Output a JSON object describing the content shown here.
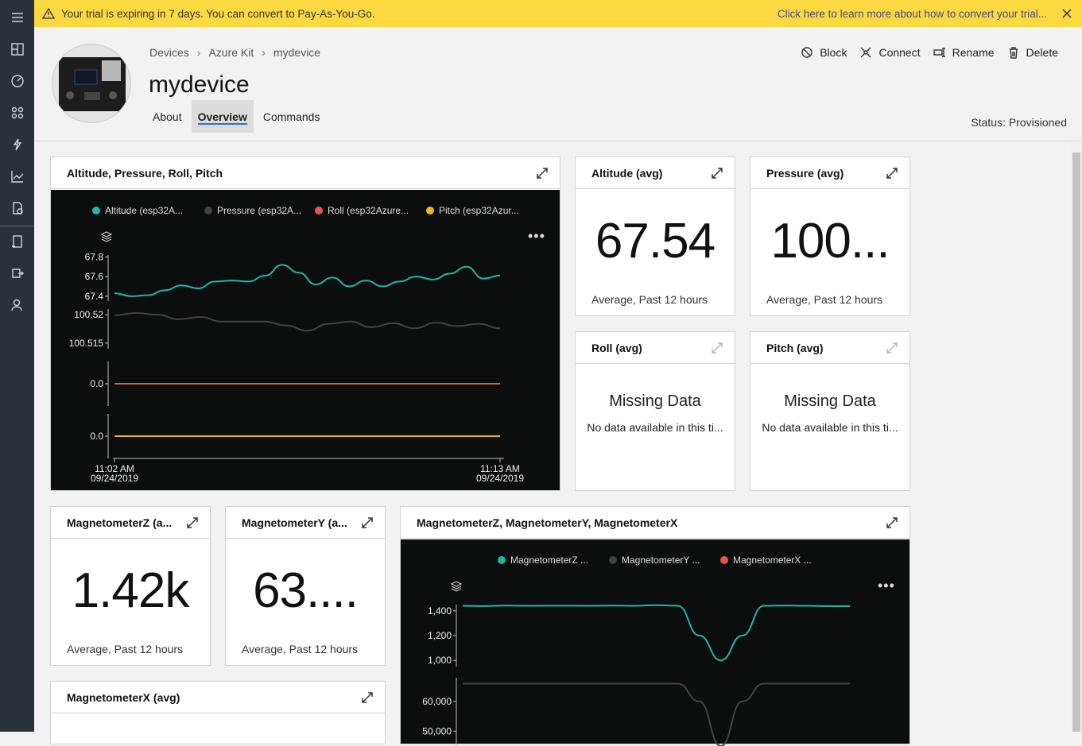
{
  "banner": {
    "message": "Your trial is expiring in 7 days. You can convert to Pay-As-You-Go.",
    "link": "Click here to learn more about how to convert your trial..."
  },
  "breadcrumbs": [
    "Devices",
    "Azure Kit",
    "mydevice"
  ],
  "device": {
    "name": "mydevice",
    "status": "Status: Provisioned"
  },
  "tabs": [
    "About",
    "Overview",
    "Commands"
  ],
  "active_tab": "Overview",
  "actions": {
    "block": "Block",
    "connect": "Connect",
    "rename": "Rename",
    "delete": "Delete"
  },
  "colors": {
    "teal": "#1bb8a6",
    "gray": "#3c4446",
    "red": "#e8544f",
    "yellow": "#e8b81c",
    "banner": "#fcd841"
  },
  "tiles": {
    "altitude": {
      "title": "Altitude (avg)",
      "value": "67.54",
      "sub": "Average, Past 12 hours"
    },
    "pressure": {
      "title": "Pressure (avg)",
      "value": "100...",
      "sub": "Average, Past 12 hours"
    },
    "roll": {
      "title": "Roll (avg)",
      "missing": "Missing Data",
      "msg": "No data available in this ti..."
    },
    "pitch": {
      "title": "Pitch (avg)",
      "missing": "Missing Data",
      "msg": "No data available in this ti..."
    },
    "magz": {
      "title": "MagnetometerZ (a...",
      "value": "1.42k",
      "sub": "Average, Past 12 hours"
    },
    "magy": {
      "title": "MagnetometerY (a...",
      "value": "63....",
      "sub": "Average, Past 12 hours"
    },
    "magx": {
      "title": "MagnetometerX (avg)"
    }
  },
  "chart1": {
    "title": "Altitude, Pressure, Roll, Pitch",
    "legend": [
      "Altitude (esp32A...",
      "Pressure (esp32A...",
      "Roll (esp32Azure...",
      "Pitch (esp32Azur..."
    ],
    "x_start": [
      "11:02 AM",
      "09/24/2019"
    ],
    "x_end": [
      "11:13 AM",
      "09/24/2019"
    ]
  },
  "chart2": {
    "title": "MagnetometerZ, MagnetometerY, MagnetometerX",
    "legend": [
      "MagnetometerZ ...",
      "MagnetometerY ...",
      "MagnetometerX ..."
    ]
  },
  "chart_data": [
    {
      "type": "line",
      "title": "Altitude, Pressure, Roll, Pitch",
      "x_range": [
        "11:02 AM 09/24/2019",
        "11:13 AM 09/24/2019"
      ],
      "series": [
        {
          "name": "Altitude (esp32A...",
          "ticks": [
            "67.8",
            "67.6",
            "67.4"
          ],
          "ylim": [
            67.35,
            67.82
          ],
          "values": [
            67.43,
            67.4,
            67.41,
            67.46,
            67.51,
            67.48,
            67.55,
            67.56,
            67.55,
            67.61,
            67.72,
            67.64,
            67.52,
            67.59,
            67.5,
            67.56,
            67.5,
            67.55,
            67.6,
            67.57,
            67.63,
            67.7,
            67.58,
            67.61
          ]
        },
        {
          "name": "Pressure (esp32A...",
          "ticks": [
            "100.52",
            "100.515"
          ],
          "ylim": [
            100.514,
            100.521
          ],
          "values": [
            100.5199,
            100.5203,
            100.52,
            100.5192,
            100.5196,
            100.5188,
            100.5188,
            100.5188,
            100.5181,
            100.5172,
            100.5184,
            100.5188,
            100.5178,
            100.5185,
            100.5176,
            100.5186,
            100.518,
            100.5184,
            100.5176
          ]
        },
        {
          "name": "Roll (esp32Azure...",
          "ticks": [
            "0.0"
          ],
          "values": [
            0.0,
            0.0
          ]
        },
        {
          "name": "Pitch (esp32Azur...",
          "ticks": [
            "0.0"
          ],
          "values": [
            0.0,
            0.0
          ]
        }
      ]
    },
    {
      "type": "line",
      "title": "MagnetometerZ, MagnetometerY, MagnetometerX",
      "series": [
        {
          "name": "MagnetometerZ ...",
          "ticks": [
            "1,400",
            "1,200",
            "1,000"
          ],
          "ylim": [
            950,
            1450
          ],
          "values": [
            1440,
            1438,
            1442,
            1440,
            1441,
            1441,
            1440,
            1442,
            1440,
            1445,
            1440,
            1200,
            1000,
            1200,
            1440,
            1442,
            1440,
            1438,
            1437
          ]
        },
        {
          "name": "MagnetometerY ...",
          "ticks": [
            "60,000",
            "50,000"
          ],
          "ylim": [
            45000,
            68000
          ],
          "values": [
            66000,
            66000,
            66000,
            66000,
            66000,
            66000,
            66000,
            66000,
            66000,
            66000,
            66000,
            60000,
            45000,
            60000,
            66000,
            66000,
            66000,
            66000,
            66000
          ]
        }
      ]
    }
  ]
}
